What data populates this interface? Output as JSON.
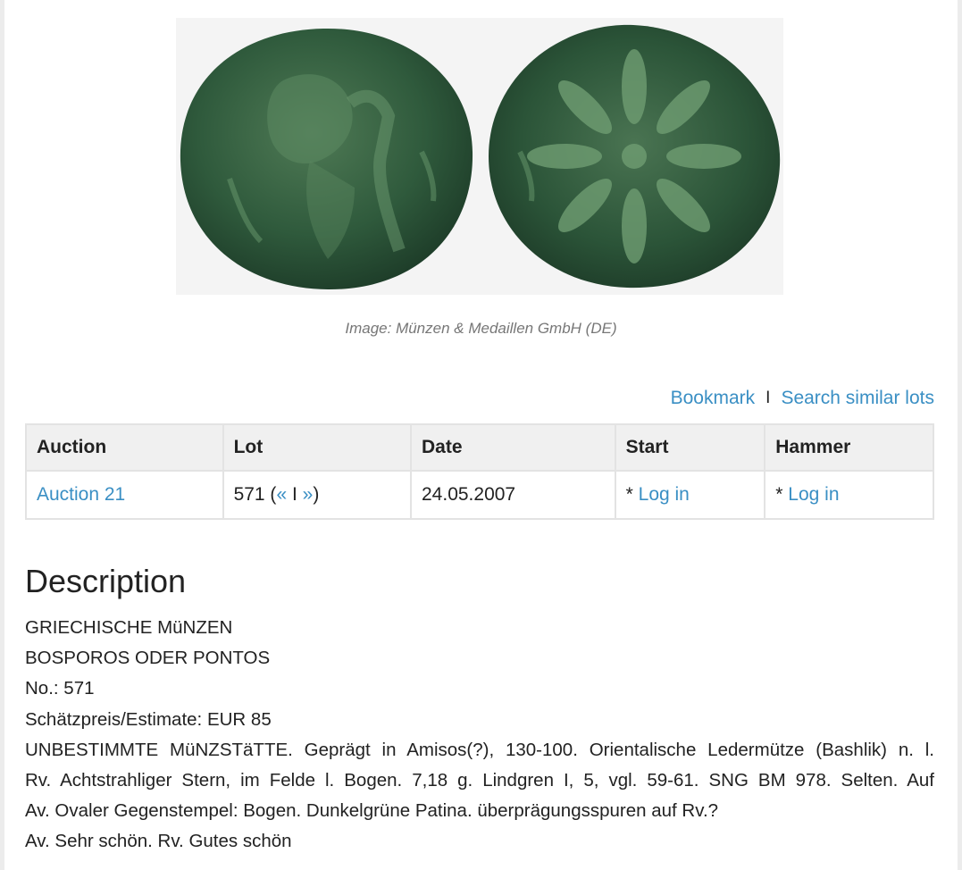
{
  "image": {
    "alt": "coin-obverse-and-reverse",
    "caption": "Image: Münzen & Medaillen GmbH (DE)"
  },
  "actions": {
    "bookmark": "Bookmark",
    "separator": "I",
    "search_similar": "Search similar lots"
  },
  "table": {
    "headers": [
      "Auction",
      "Lot",
      "Date",
      "Start",
      "Hammer"
    ],
    "row": {
      "auction": "Auction 21",
      "lot_number": "571 (",
      "lot_prev": "«",
      "lot_sep": " I ",
      "lot_next": "»",
      "lot_close": ")",
      "date": "24.05.2007",
      "start_prefix": "* ",
      "start_link": "Log in",
      "hammer_prefix": "* ",
      "hammer_link": "Log in"
    }
  },
  "description": {
    "title": "Description",
    "lines": [
      "GRIECHISCHE MüNZEN",
      "BOSPOROS ODER PONTOS",
      "No.: 571",
      "Schätzpreis/Estimate: EUR 85",
      "UNBESTIMMTE MüNZSTäTTE. Geprägt in Amisos(?), 130-100. Orientalische Ledermütze (Bashlik) n. l.",
      "Rv. Achtstrahliger Stern, im Felde l. Bogen. 7,18 g. Lindgren I, 5, vgl. 59-61. SNG BM 978. Selten. Auf",
      "Av. Ovaler Gegenstempel: Bogen. Dunkelgrüne Patina. überprägungsspuren auf Rv.?",
      "Av. Sehr schön. Rv. Gutes schön"
    ]
  },
  "colors": {
    "link": "#3a8fc4",
    "coin": "#2f5a3c",
    "header_bg": "#f0f0f0"
  }
}
